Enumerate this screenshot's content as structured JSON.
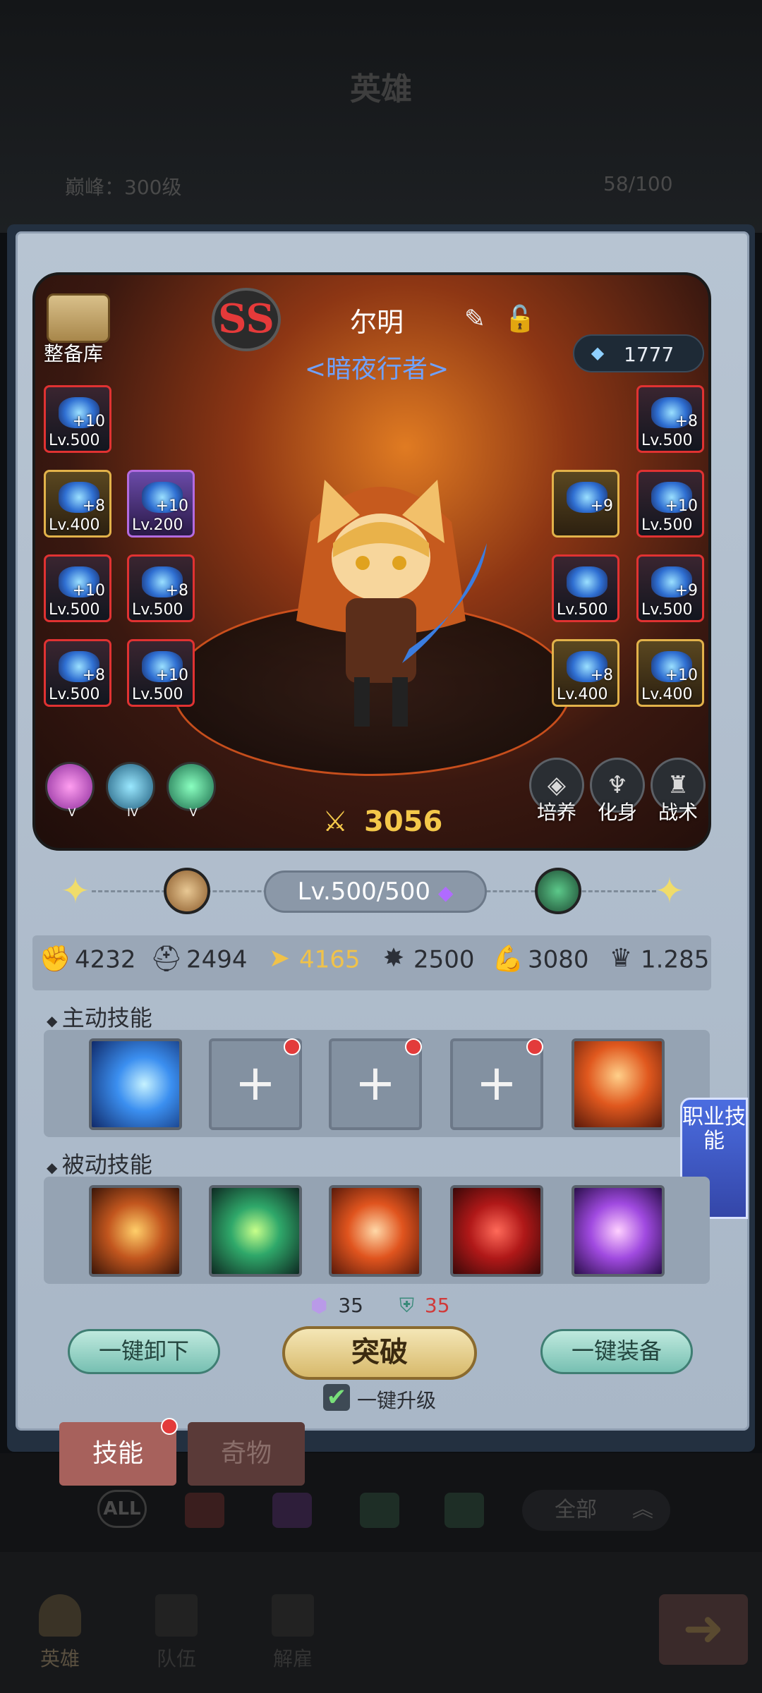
{
  "header": {
    "title": "英雄",
    "peak": "巅峰：300级",
    "count": "58/100"
  },
  "warehouse": {
    "label": "整备库"
  },
  "hero": {
    "rank": "SS",
    "name": "尔明",
    "title": "<暗夜行者>",
    "gems": "1777",
    "power": "3056"
  },
  "equip_left": [
    {
      "plus": "+10",
      "lv": "Lv.500",
      "rarity": "red"
    },
    {
      "plus": "+8",
      "lv": "Lv.400",
      "rarity": "gold"
    },
    {
      "plus": "+10",
      "lv": "Lv.200",
      "rarity": "purple"
    },
    {
      "plus": "+10",
      "lv": "Lv.500",
      "rarity": "red"
    },
    {
      "plus": "+8",
      "lv": "Lv.500",
      "rarity": "red"
    },
    {
      "plus": "+8",
      "lv": "Lv.500",
      "rarity": "red"
    },
    {
      "plus": "+10",
      "lv": "Lv.500",
      "rarity": "red"
    }
  ],
  "equip_right": [
    {
      "plus": "+8",
      "lv": "Lv.500",
      "rarity": "red"
    },
    {
      "plus": "+9",
      "lv": "",
      "rarity": "gold"
    },
    {
      "plus": "+10",
      "lv": "Lv.500",
      "rarity": "red"
    },
    {
      "plus": "",
      "lv": "Lv.500",
      "rarity": "red"
    },
    {
      "plus": "+9",
      "lv": "Lv.500",
      "rarity": "red"
    },
    {
      "plus": "+8",
      "lv": "Lv.400",
      "rarity": "gold"
    },
    {
      "plus": "+10",
      "lv": "Lv.400",
      "rarity": "gold"
    }
  ],
  "runes": [
    "V",
    "IV",
    "V"
  ],
  "actions": [
    "培养",
    "化身",
    "战术"
  ],
  "level": {
    "text": "Lv.500/500"
  },
  "stats": [
    "4232",
    "2494",
    "4165",
    "2500",
    "3080",
    "1.285"
  ],
  "skills": {
    "active_label": "主动技能",
    "passive_label": "被动技能",
    "side_tab": "职业技能"
  },
  "costs": {
    "crystal": "35",
    "shield": "35"
  },
  "buttons": {
    "unequip": "一键卸下",
    "breakthrough": "突破",
    "equip": "一键装备",
    "auto_upgrade": "一键升级"
  },
  "tabs": {
    "skills": "技能",
    "artifacts": "奇物"
  },
  "filter": {
    "all": "ALL",
    "select": "全部"
  },
  "nav": {
    "hero": "英雄",
    "team": "队伍",
    "dismiss": "解雇"
  }
}
